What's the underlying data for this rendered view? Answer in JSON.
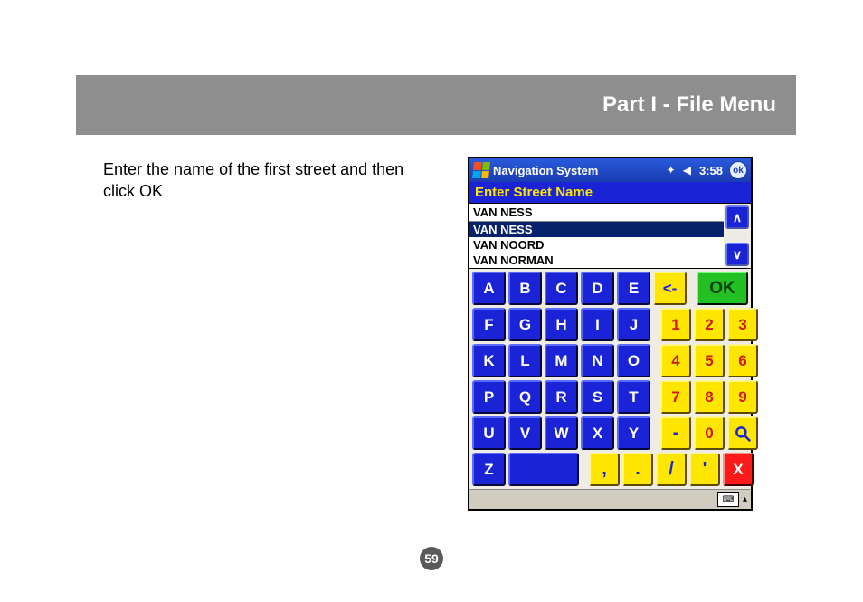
{
  "header": {
    "title": "Part I - File Menu"
  },
  "instruction": "Enter the name of the first street and then click OK",
  "page_number": "59",
  "pda": {
    "titlebar": {
      "app_name": "Navigation System",
      "time": "3:58",
      "ok": "ok"
    },
    "prompt": "Enter Street Name",
    "input_value": "VAN NESS",
    "list": [
      "VAN NESS",
      "VAN NOORD",
      "VAN NORMAN"
    ],
    "selected_index": 0,
    "scroll": {
      "up": "∧",
      "down": "∨"
    },
    "keys": {
      "row1_letters": [
        "A",
        "B",
        "C",
        "D",
        "E"
      ],
      "backspace": "<-",
      "ok": "OK",
      "row2_letters": [
        "F",
        "G",
        "H",
        "I",
        "J"
      ],
      "row2_nums": [
        "1",
        "2",
        "3"
      ],
      "row3_letters": [
        "K",
        "L",
        "M",
        "N",
        "O"
      ],
      "row3_nums": [
        "4",
        "5",
        "6"
      ],
      "row4_letters": [
        "P",
        "Q",
        "R",
        "S",
        "T"
      ],
      "row4_nums": [
        "7",
        "8",
        "9"
      ],
      "row5_letters": [
        "U",
        "V",
        "W",
        "X",
        "Y"
      ],
      "row5_sym": [
        "-",
        "0"
      ],
      "row6_letter": "Z",
      "row6_punct": [
        ",",
        ".",
        "/",
        "'"
      ],
      "delete": "X"
    },
    "sip": "⌨"
  }
}
